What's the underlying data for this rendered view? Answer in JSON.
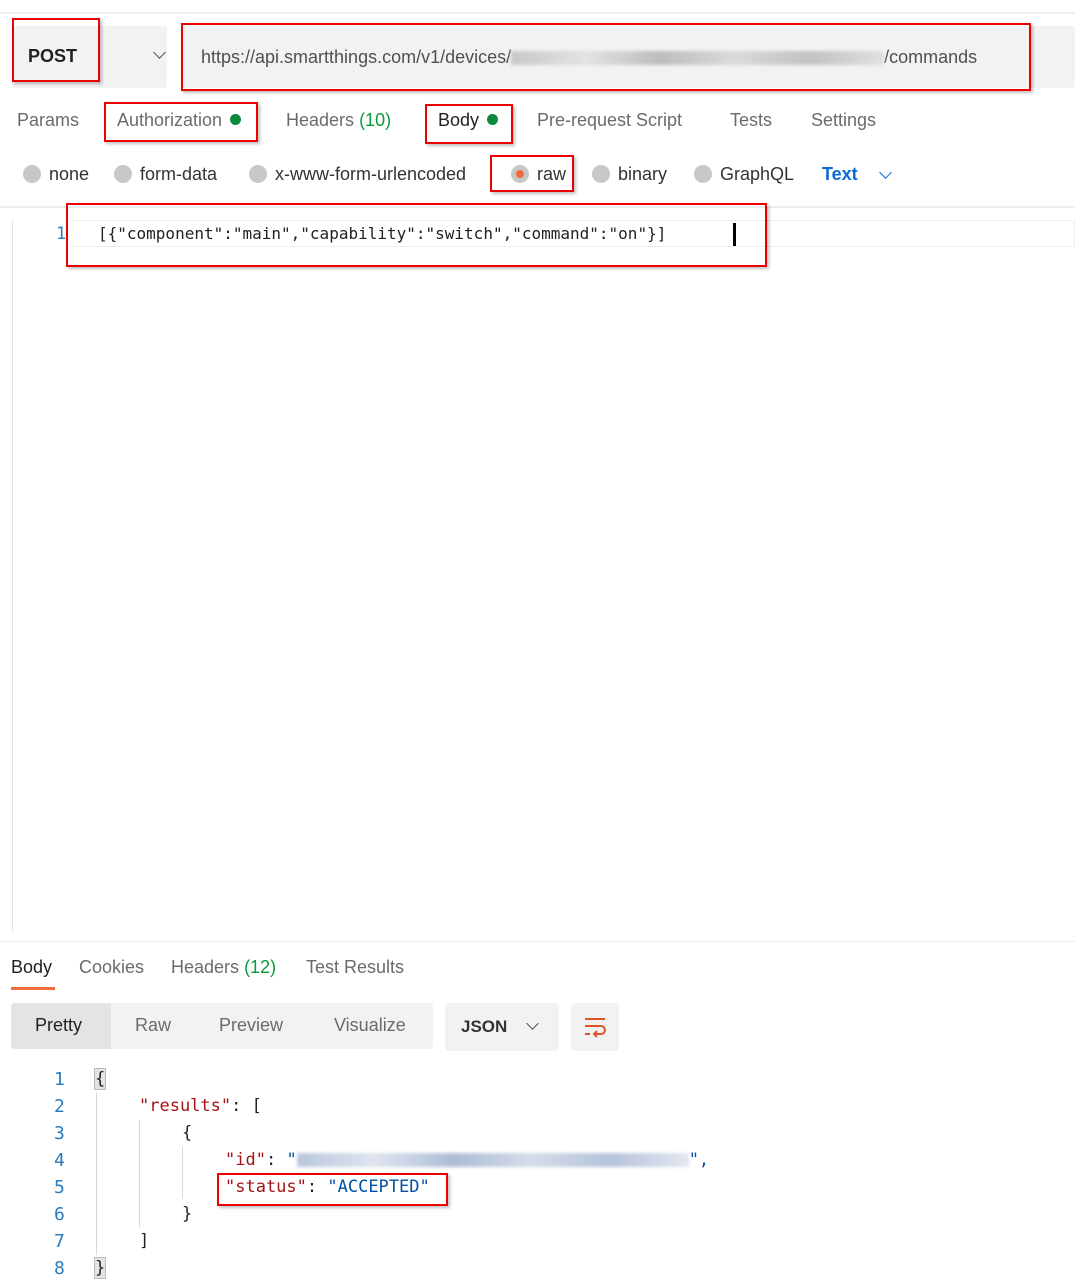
{
  "request": {
    "method": "POST",
    "url_prefix": "https://api.smartthings.com/v1/devices/",
    "url_suffix": "/commands"
  },
  "tabs": {
    "params": "Params",
    "authorization": "Authorization",
    "headers": "Headers",
    "headers_count": "(10)",
    "body": "Body",
    "prerequest": "Pre-request Script",
    "tests": "Tests",
    "settings": "Settings"
  },
  "body_types": {
    "none": "none",
    "form_data": "form-data",
    "urlencoded": "x-www-form-urlencoded",
    "raw": "raw",
    "binary": "binary",
    "graphql": "GraphQL",
    "format": "Text",
    "selected": "raw"
  },
  "editor": {
    "line_number": "1",
    "content": "[{\"component\":\"main\",\"capability\":\"switch\",\"command\":\"on\"}]"
  },
  "response": {
    "tabs": {
      "body": "Body",
      "cookies": "Cookies",
      "headers": "Headers",
      "headers_count": "(12)",
      "test_results": "Test Results"
    },
    "views": {
      "pretty": "Pretty",
      "raw": "Raw",
      "preview": "Preview",
      "visualize": "Visualize",
      "format": "JSON"
    },
    "lines": [
      "1",
      "2",
      "3",
      "4",
      "5",
      "6",
      "7",
      "8"
    ],
    "code": {
      "open": "{",
      "results_key": "\"results\"",
      "colon": ": ",
      "open_arr": "[",
      "open_obj": "{",
      "id_key": "\"id\"",
      "id_q": "\"",
      "id_end": "\",",
      "status_key": "\"status\"",
      "status_value": "\"ACCEPTED\"",
      "close_obj": "}",
      "close_arr": "]",
      "close": "}"
    }
  },
  "colors": {
    "accent": "#f26b3a",
    "highlight": "#e00000",
    "dot": "#0a8a3a"
  }
}
